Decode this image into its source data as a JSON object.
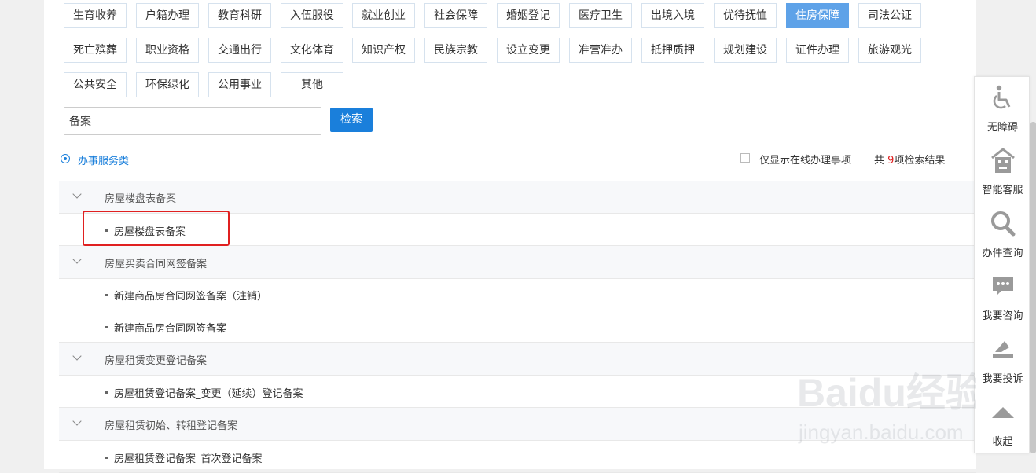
{
  "categories": [
    {
      "label": "生育收养",
      "active": false
    },
    {
      "label": "户籍办理",
      "active": false
    },
    {
      "label": "教育科研",
      "active": false
    },
    {
      "label": "入伍服役",
      "active": false
    },
    {
      "label": "就业创业",
      "active": false
    },
    {
      "label": "社会保障",
      "active": false
    },
    {
      "label": "婚姻登记",
      "active": false
    },
    {
      "label": "医疗卫生",
      "active": false
    },
    {
      "label": "出境入境",
      "active": false
    },
    {
      "label": "优待抚恤",
      "active": false
    },
    {
      "label": "住房保障",
      "active": true
    },
    {
      "label": "司法公证",
      "active": false
    },
    {
      "label": "死亡殡葬",
      "active": false
    },
    {
      "label": "职业资格",
      "active": false
    },
    {
      "label": "交通出行",
      "active": false
    },
    {
      "label": "文化体育",
      "active": false
    },
    {
      "label": "知识产权",
      "active": false
    },
    {
      "label": "民族宗教",
      "active": false
    },
    {
      "label": "设立变更",
      "active": false
    },
    {
      "label": "准营准办",
      "active": false
    },
    {
      "label": "抵押质押",
      "active": false
    },
    {
      "label": "规划建设",
      "active": false
    },
    {
      "label": "证件办理",
      "active": false
    },
    {
      "label": "旅游观光",
      "active": false
    },
    {
      "label": "公共安全",
      "active": false
    },
    {
      "label": "环保绿化",
      "active": false
    },
    {
      "label": "公用事业",
      "active": false
    },
    {
      "label": "其他",
      "active": false
    }
  ],
  "search": {
    "value": "备案",
    "button_label": "检索"
  },
  "filter": {
    "service_type_label": "办事服务类",
    "online_only_label": "仅显示在线办理事项",
    "result_prefix": "共 ",
    "result_count": "9",
    "result_suffix": "项检索结果"
  },
  "results": [
    {
      "type": "group",
      "label": "房屋楼盘表备案"
    },
    {
      "type": "item",
      "label": "房屋楼盘表备案",
      "highlighted": true
    },
    {
      "type": "group",
      "label": "房屋买卖合同网签备案"
    },
    {
      "type": "item",
      "label": "新建商品房合同网签备案（注销）"
    },
    {
      "type": "item",
      "label": "新建商品房合同网签备案"
    },
    {
      "type": "group",
      "label": "房屋租赁变更登记备案"
    },
    {
      "type": "item",
      "label": "房屋租赁登记备案_变更（延续）登记备案"
    },
    {
      "type": "group",
      "label": "房屋租赁初始、转租登记备案"
    },
    {
      "type": "item",
      "label": "房屋租赁登记备案_首次登记备案"
    }
  ],
  "sidebar": {
    "items": [
      {
        "label": "无障碍",
        "icon": "wheelchair-icon"
      },
      {
        "label": "智能客服",
        "icon": "robot-house-icon"
      },
      {
        "label": "办件查询",
        "icon": "search-icon"
      },
      {
        "label": "我要咨询",
        "icon": "chat-icon"
      },
      {
        "label": "我要投诉",
        "icon": "complaint-icon"
      },
      {
        "label": "收起",
        "icon": "triangle-up-icon"
      }
    ]
  },
  "watermark": {
    "brand": "Baidu经验",
    "url": "jingyan.baidu.com"
  }
}
